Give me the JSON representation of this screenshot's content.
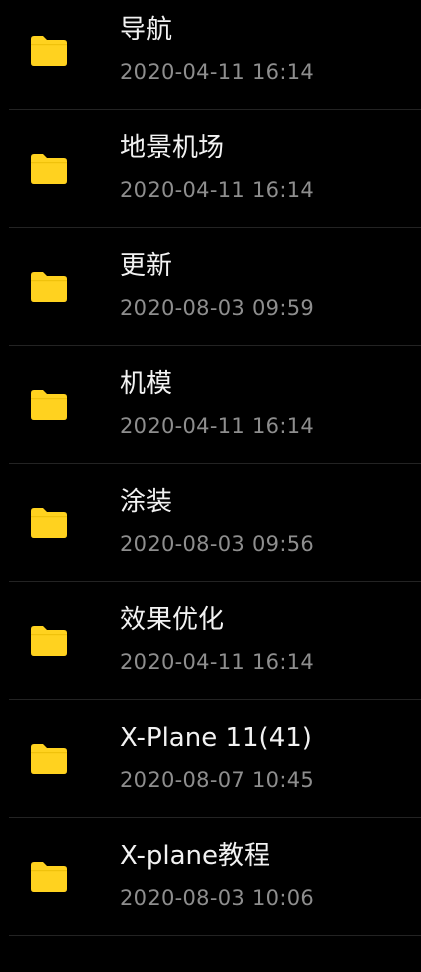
{
  "accent_color": "#FFD21F",
  "items": [
    {
      "name": "导航",
      "date": "2020-04-11 16:14",
      "icon": "folder-icon"
    },
    {
      "name": "地景机场",
      "date": "2020-04-11 16:14",
      "icon": "folder-icon"
    },
    {
      "name": "更新",
      "date": "2020-08-03 09:59",
      "icon": "folder-icon"
    },
    {
      "name": "机模",
      "date": "2020-04-11 16:14",
      "icon": "folder-icon"
    },
    {
      "name": "涂装",
      "date": "2020-08-03 09:56",
      "icon": "folder-icon"
    },
    {
      "name": "效果优化",
      "date": "2020-04-11 16:14",
      "icon": "folder-icon"
    },
    {
      "name": "X-Plane 11(41)",
      "date": "2020-08-07 10:45",
      "icon": "folder-icon"
    },
    {
      "name": "X-plane教程",
      "date": "2020-08-03 10:06",
      "icon": "folder-icon"
    }
  ]
}
